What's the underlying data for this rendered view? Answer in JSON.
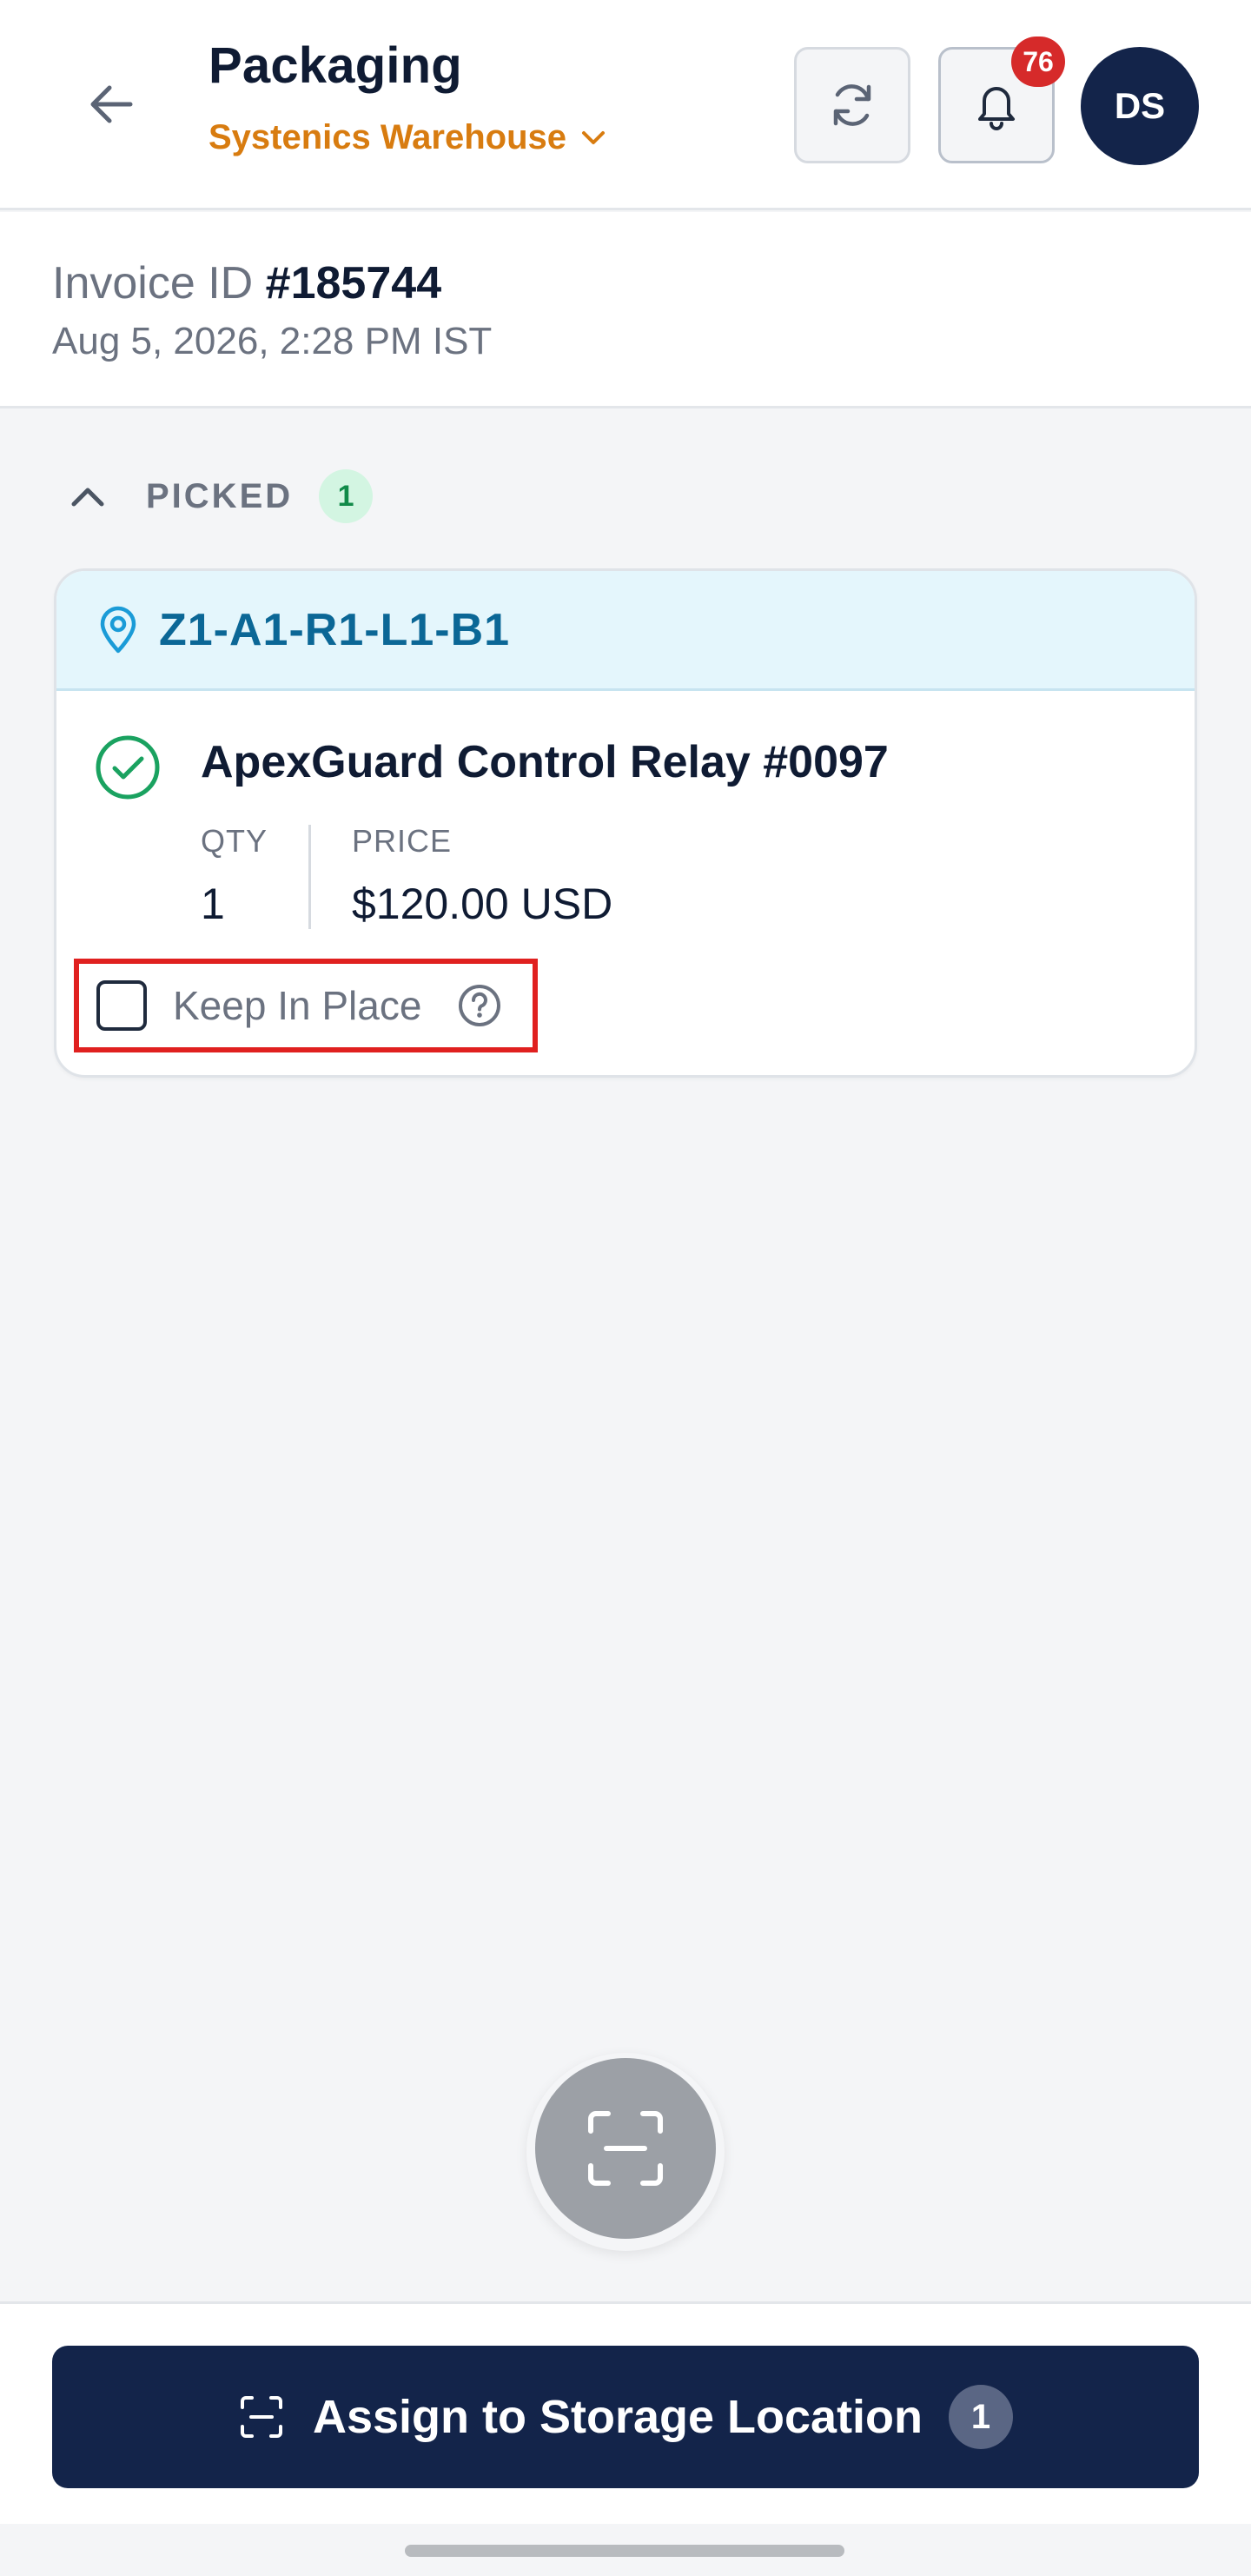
{
  "header": {
    "title": "Packaging",
    "warehouse": "Systenics Warehouse",
    "notification_count": "76",
    "avatar_initials": "DS"
  },
  "invoice": {
    "label": "Invoice ID",
    "id": "#185744",
    "datetime": "Aug 5, 2026, 2:28 PM IST"
  },
  "section": {
    "label": "PICKED",
    "count": "1"
  },
  "card": {
    "location": "Z1-A1-R1-L1-B1",
    "item_name": "ApexGuard Control Relay #0097",
    "qty_label": "QTY",
    "qty_value": "1",
    "price_label": "PRICE",
    "price_value": "$120.00 USD",
    "keep_in_place_label": "Keep In Place",
    "keep_in_place_checked": false
  },
  "footer": {
    "assign_label": "Assign to Storage Location",
    "assign_count": "1"
  },
  "colors": {
    "primary": "#13244a",
    "accent_orange": "#d87c10",
    "location_blue": "#0b6796",
    "success_green": "#1aa260",
    "badge_red": "#d62a2a",
    "highlight_red": "#e0201f"
  }
}
